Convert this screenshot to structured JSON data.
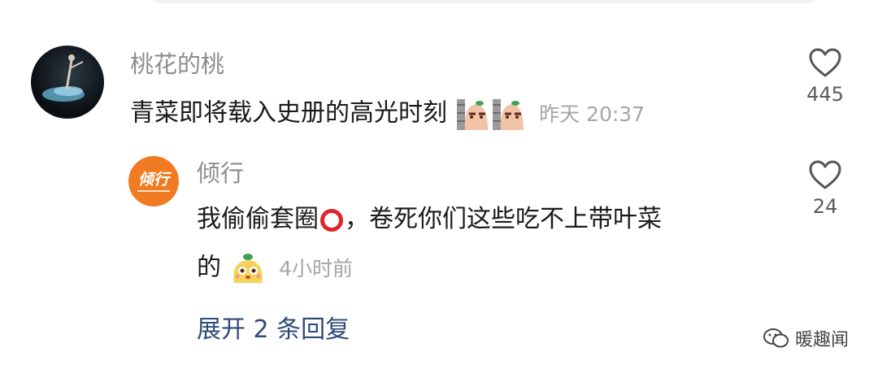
{
  "comment": {
    "author": "桃花的桃",
    "text": "青菜即将载入史册的高光时刻",
    "emojis": [
      "potato-peek-icon",
      "potato-peek-icon"
    ],
    "time": "昨天 20:37",
    "likes": "445"
  },
  "reply": {
    "author": "倾行",
    "avatar_text": "倾行",
    "text_line1_a": "我偷偷套圈",
    "text_line1_b": "，卷死你们这些吃不上带叶菜",
    "text_line2": "的",
    "time": "4小时前",
    "likes": "24"
  },
  "expand_label": "展开 2 条回复",
  "watermark": "暖趣闻",
  "colors": {
    "accent": "#2e4a78",
    "brand": "#f07b22",
    "red": "#e2232e"
  }
}
